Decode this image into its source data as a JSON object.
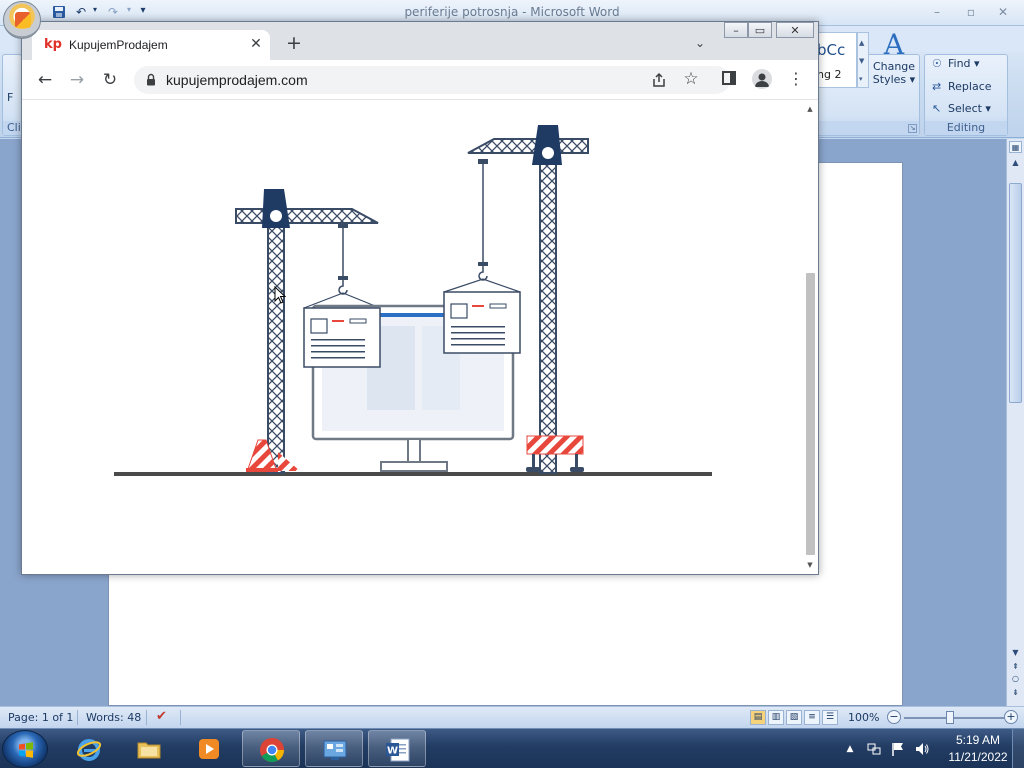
{
  "word": {
    "title": "periferije potrosnja - Microsoft Word",
    "window_controls": {
      "minimize": "–",
      "maximize": "▫",
      "close": "✕"
    },
    "qat": {
      "undo": "↶",
      "redo": "↷",
      "customize": "▾"
    },
    "ribbon": {
      "left_edge_label": "F",
      "clipboard_label": "Cli",
      "styles": {
        "gallery_item_1": "bCc",
        "gallery_item_2": "ng 2",
        "change_styles_line1": "Change",
        "change_styles_line2": "Styles ▾"
      },
      "editing": {
        "find": "Find ▾",
        "replace": "Replace",
        "select": "Select ▾",
        "group_label": "Editing"
      }
    },
    "status": {
      "page": "Page: 1 of 1",
      "words": "Words: 48",
      "zoom": "100%"
    }
  },
  "browser": {
    "tab": {
      "favicon": "kp",
      "title": "KupujemProdajem",
      "close": "✕"
    },
    "new_tab": "+",
    "tab_search": "⌄",
    "url": "kupujemprodajem.com",
    "nav": {
      "back": "←",
      "forward": "→",
      "reload": "↻",
      "star": "☆",
      "menu": "⋮"
    },
    "window_controls": {
      "minimize": "–",
      "maximize": "▭",
      "close": "✕"
    }
  },
  "taskbar": {
    "clock_time": "5:19 AM",
    "clock_date": "11/21/2022",
    "tray_expand": "▲"
  },
  "colors": {
    "crane": "#3a4b66",
    "crane_dark": "#1f3a63",
    "warning_red": "#e8473c",
    "accent_blue": "#2a6fc4",
    "ground": "#4a4a4a"
  }
}
